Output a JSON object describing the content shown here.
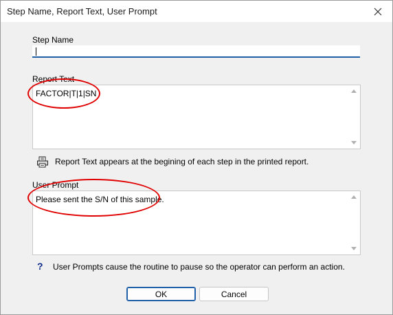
{
  "window": {
    "title": "Step Name, Report Text, User Prompt"
  },
  "step_name": {
    "label": "Step Name",
    "value": ""
  },
  "report_text": {
    "label": "Report Text",
    "value": "FACTOR|T|1|SN",
    "hint": "Report Text appears at the begining of each step in the printed report."
  },
  "user_prompt": {
    "label": "User Prompt",
    "value": "Please sent the S/N of this sample.",
    "hint": "User Prompts cause the routine to pause so the operator can perform an action.",
    "hint_icon": "?"
  },
  "buttons": {
    "ok": "OK",
    "cancel": "Cancel"
  },
  "colors": {
    "annotation": "#e00000",
    "focus_accent": "#1f5fa8"
  },
  "icons": {
    "close": "close-icon",
    "printer": "printer-icon",
    "help": "question-mark-icon"
  }
}
